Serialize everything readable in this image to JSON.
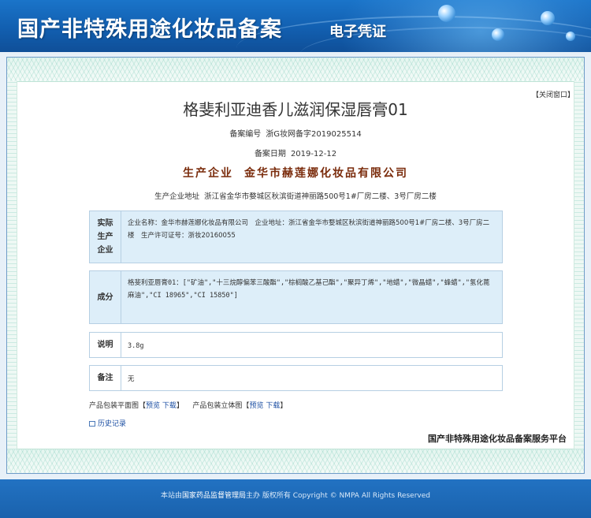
{
  "header": {
    "title": "国产非特殊用途化妆品备案",
    "subtitle": "电子凭证"
  },
  "close_window": {
    "left_bracket": "【",
    "label": "关闭窗口",
    "right_bracket": "】"
  },
  "product": {
    "name": "格斐利亚迪香儿滋润保湿唇膏01",
    "record_number_label": "备案编号",
    "record_number": "浙G妆网备字2019025514",
    "record_date_label": "备案日期",
    "record_date": "2019-12-12",
    "company_label": "生产企业",
    "company_name": "金华市赫莲娜化妆品有限公司",
    "company_address_label": "生产企业地址",
    "company_address": "浙江省金华市婺城区秋滨街道神丽路500号1#厂房二楼、3号厂房二楼"
  },
  "sections": {
    "actual_producer": {
      "label_chars": [
        "实际",
        "生产",
        "企业"
      ],
      "content": "企业名称：金华市赫莲娜化妆品有限公司　企业地址：浙江省金华市婺城区秋滨街道神丽路500号1#厂房二楼、3号厂房二楼　生产许可证号：浙妆20160055"
    },
    "ingredients": {
      "label": "成分",
      "content": "格斐利亚唇膏01：[\"矿油\",\"十三烷醇偏苯三酸酯\",\"棕榈酸乙基己酯\",\"聚异丁烯\",\"地蜡\",\"微晶蜡\",\"蜂蜡\",\"氢化蓖麻油\",\"CI 18965\",\"CI 15850\"]"
    },
    "description": {
      "label": "说明",
      "content": "3.8g"
    },
    "remarks": {
      "label": "备注",
      "content": "无"
    }
  },
  "downloads": {
    "flat_label": "产品包装平面图",
    "solid_label": "产品包装立体图",
    "open_bracket": "【",
    "close_bracket": "】",
    "preview": "预览",
    "download": "下载"
  },
  "history": {
    "label": "历史记录"
  },
  "platform_stamp": "国产非特殊用途化妆品备案服务平台",
  "footer": {
    "prefix": "本站由",
    "org": "国家药品监督管理局",
    "suffix": "主办 版权所有 Copyright © NMPA All Rights Reserved"
  },
  "colors": {
    "header_blue": "#1a6bc0",
    "company_brown": "#7a2b0b",
    "link_blue": "#1c4fa3",
    "section_bg": "#ddeef9"
  }
}
